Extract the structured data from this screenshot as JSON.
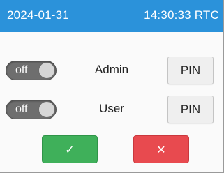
{
  "header": {
    "date": "2024-01-31",
    "time": "14:30:33 RTC",
    "background_color": "#2b92da"
  },
  "rows": [
    {
      "label": "Admin",
      "toggle": {
        "state_label": "off",
        "on": false
      },
      "pin_button_label": "PIN"
    },
    {
      "label": "User",
      "toggle": {
        "state_label": "off",
        "on": false
      },
      "pin_button_label": "PIN"
    }
  ],
  "actions": {
    "confirm": {
      "glyph": "✓",
      "icon": "check-icon",
      "color": "#3fb05a"
    },
    "cancel": {
      "glyph": "✕",
      "icon": "close-icon",
      "color": "#e84a4f"
    }
  }
}
